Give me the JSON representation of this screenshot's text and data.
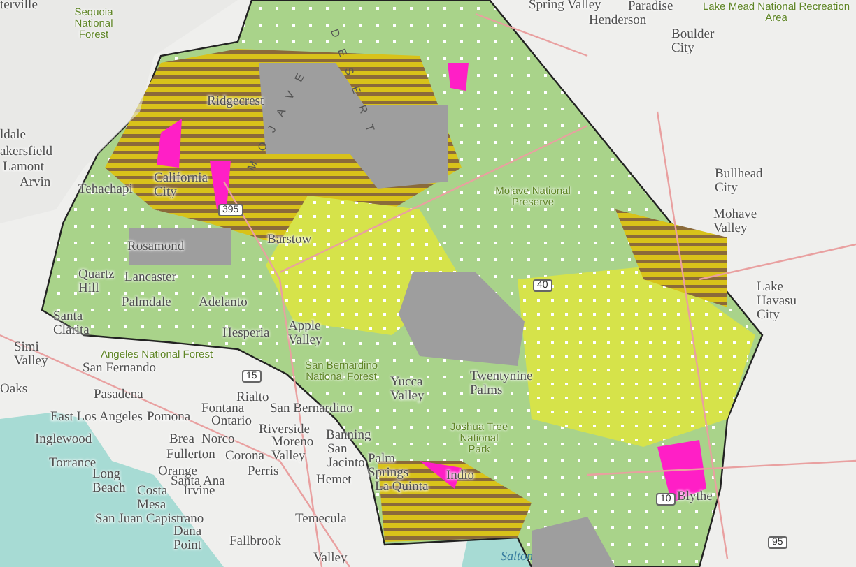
{
  "map": {
    "labels": [
      {
        "text": "terville",
        "kind": "city"
      },
      {
        "text": "Sequoia National Forest",
        "kind": "park"
      },
      {
        "text": "Spring Valley",
        "kind": "city"
      },
      {
        "text": "Paradise",
        "kind": "city"
      },
      {
        "text": "Henderson",
        "kind": "city"
      },
      {
        "text": "Lake Mead National Recreation Area",
        "kind": "park"
      },
      {
        "text": "Boulder City",
        "kind": "city"
      },
      {
        "text": "Ridgecrest",
        "kind": "city"
      },
      {
        "text": "DESERT",
        "kind": "region"
      },
      {
        "text": "ldale",
        "kind": "city"
      },
      {
        "text": "akersfield",
        "kind": "city"
      },
      {
        "text": "Lamont",
        "kind": "city"
      },
      {
        "text": "Arvin",
        "kind": "city"
      },
      {
        "text": "Tehachapi",
        "kind": "city"
      },
      {
        "text": "California City",
        "kind": "city"
      },
      {
        "text": "Bullhead City",
        "kind": "city"
      },
      {
        "text": "Mojave National Preserve",
        "kind": "park"
      },
      {
        "text": "395",
        "kind": "shield"
      },
      {
        "text": "MOJAVE",
        "kind": "region"
      },
      {
        "text": "Barstow",
        "kind": "city"
      },
      {
        "text": "Mohave Valley",
        "kind": "city"
      },
      {
        "text": "Rosamond",
        "kind": "city"
      },
      {
        "text": "Quartz Hill",
        "kind": "city"
      },
      {
        "text": "Lancaster",
        "kind": "city"
      },
      {
        "text": "40",
        "kind": "shield"
      },
      {
        "text": "Palmdale",
        "kind": "city"
      },
      {
        "text": "Adelanto",
        "kind": "city"
      },
      {
        "text": "Santa Clarita",
        "kind": "city"
      },
      {
        "text": "Hesperia",
        "kind": "city"
      },
      {
        "text": "Apple Valley",
        "kind": "city"
      },
      {
        "text": "Lake Havasu City",
        "kind": "city"
      },
      {
        "text": "Simi Valley",
        "kind": "city"
      },
      {
        "text": "Angeles National Forest",
        "kind": "park"
      },
      {
        "text": "San Fernando",
        "kind": "city"
      },
      {
        "text": "Oaks",
        "kind": "city"
      },
      {
        "text": "15",
        "kind": "shield"
      },
      {
        "text": "San Bernardino National Forest",
        "kind": "park"
      },
      {
        "text": "Yucca Valley",
        "kind": "city"
      },
      {
        "text": "Twentynine Palms",
        "kind": "city"
      },
      {
        "text": "Pasadena",
        "kind": "city"
      },
      {
        "text": "Rialto",
        "kind": "city"
      },
      {
        "text": "Fontana",
        "kind": "city"
      },
      {
        "text": "San Bernardino",
        "kind": "city"
      },
      {
        "text": "East Los Angeles",
        "kind": "city"
      },
      {
        "text": "Pomona",
        "kind": "city"
      },
      {
        "text": "Ontario",
        "kind": "city"
      },
      {
        "text": "Inglewood",
        "kind": "city"
      },
      {
        "text": "Brea",
        "kind": "city"
      },
      {
        "text": "Norco",
        "kind": "city"
      },
      {
        "text": "Riverside",
        "kind": "city"
      },
      {
        "text": "Moreno Valley",
        "kind": "city"
      },
      {
        "text": "Banning",
        "kind": "city"
      },
      {
        "text": "San Jacinto",
        "kind": "city"
      },
      {
        "text": "Palm Springs",
        "kind": "city"
      },
      {
        "text": "Fullerton",
        "kind": "city"
      },
      {
        "text": "Corona",
        "kind": "city"
      },
      {
        "text": "Joshua Tree National Park",
        "kind": "park"
      },
      {
        "text": "Torrance",
        "kind": "city"
      },
      {
        "text": "Long Beach",
        "kind": "city"
      },
      {
        "text": "Orange",
        "kind": "city"
      },
      {
        "text": "Santa Ana",
        "kind": "city"
      },
      {
        "text": "Perris",
        "kind": "city"
      },
      {
        "text": "Hemet",
        "kind": "city"
      },
      {
        "text": "Costa Mesa",
        "kind": "city"
      },
      {
        "text": "Irvine",
        "kind": "city"
      },
      {
        "text": "La Quinta",
        "kind": "city"
      },
      {
        "text": "Indio",
        "kind": "city"
      },
      {
        "text": "10",
        "kind": "shield"
      },
      {
        "text": "Blythe",
        "kind": "city"
      },
      {
        "text": "San Juan Capistrano",
        "kind": "city"
      },
      {
        "text": "Temecula",
        "kind": "city"
      },
      {
        "text": "Dana Point",
        "kind": "city"
      },
      {
        "text": "Fallbrook",
        "kind": "city"
      },
      {
        "text": "Valley",
        "kind": "city"
      },
      {
        "text": "95",
        "kind": "shield"
      },
      {
        "text": "Salton",
        "kind": "water"
      }
    ]
  }
}
